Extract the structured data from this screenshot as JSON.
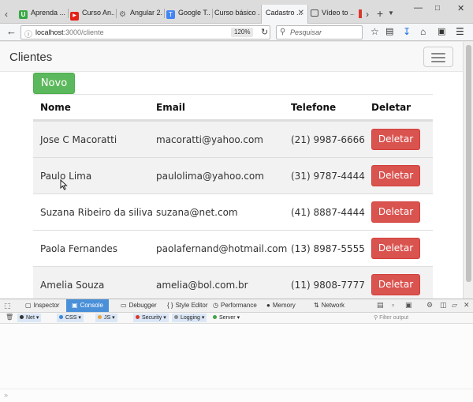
{
  "browser": {
    "tabs": [
      {
        "label": "Aprenda ...",
        "favicon_color": "#39a845",
        "favicon": "U"
      },
      {
        "label": "Curso An...",
        "favicon_color": "#e62117",
        "favicon": "▶"
      },
      {
        "label": "Angular 2...",
        "favicon_color": "#888888",
        "favicon": "⚙"
      },
      {
        "label": "Google T...",
        "favicon_color": "#4285f4",
        "favicon": "T"
      },
      {
        "label": "Curso básico ...",
        "favicon_color": "#bbbbbb",
        "favicon": ""
      },
      {
        "label": "Cadastro ...",
        "favicon_color": "#cccccc",
        "favicon": "",
        "active": true
      },
      {
        "label": "Vídeo to ...",
        "favicon_color": "#555555",
        "favicon": "▣"
      }
    ],
    "url_host": "localhost",
    "url_path": ":3000/cliente",
    "zoom": "120%",
    "search_placeholder": "Pesquisar"
  },
  "page": {
    "brand": "Clientes",
    "new_button": "Novo",
    "table": {
      "headers": [
        "Nome",
        "Email",
        "Telefone",
        "Deletar"
      ],
      "rows": [
        {
          "nome": "Jose C Macoratti",
          "email": "macoratti@yahoo.com",
          "telefone": "(21) 9987-6666",
          "acao": "Deletar"
        },
        {
          "nome": "Paulo Lima",
          "email": "paulolima@yahoo.com",
          "telefone": "(31) 9787-4444",
          "acao": "Deletar"
        },
        {
          "nome": "Suzana Ribeiro da siliva",
          "email": "suzana@net.com",
          "telefone": "(41) 8887-4444",
          "acao": "Deletar"
        },
        {
          "nome": "Paola Fernandes",
          "email": "paolafernand@hotmail.com",
          "telefone": "(13) 8987-5555",
          "acao": "Deletar"
        },
        {
          "nome": "Amelia Souza",
          "email": "amelia@bol.com.br",
          "telefone": "(11) 9808-7777",
          "acao": "Deletar"
        }
      ]
    }
  },
  "devtools": {
    "tabs": [
      "Inspector",
      "Console",
      "Debugger",
      "Style Editor",
      "Performance",
      "Memory",
      "Network"
    ],
    "active_tab": "Console",
    "filters": [
      {
        "label": "Net",
        "color": "#333333"
      },
      {
        "label": "CSS",
        "color": "#3b86d6"
      },
      {
        "label": "JS",
        "color": "#e8a33d"
      },
      {
        "label": "Security",
        "color": "#d9382d"
      },
      {
        "label": "Logging",
        "color": "#888888"
      },
      {
        "label": "Server",
        "color": "#41a34a"
      }
    ],
    "filter_placeholder": "Filter output",
    "prompt": "»"
  },
  "colors": {
    "success": "#5cb85c",
    "danger": "#d9534f",
    "devtools_accent": "#4a90d9"
  }
}
